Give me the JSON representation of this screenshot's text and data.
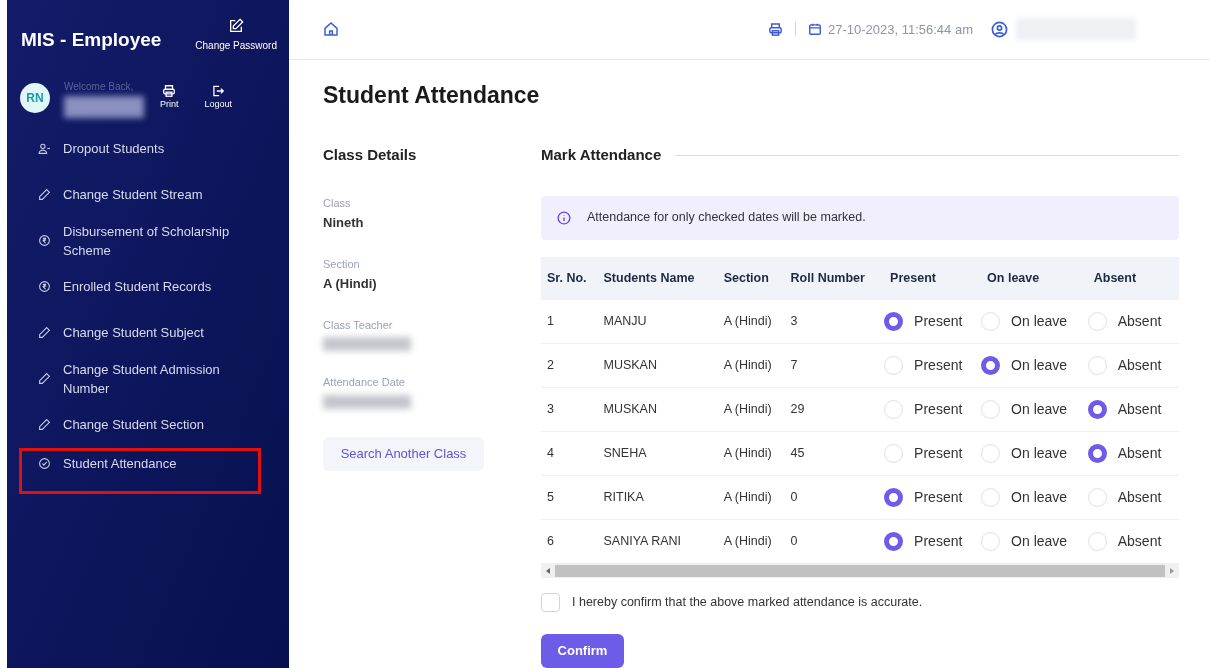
{
  "sidebar": {
    "app_title": "MIS - Employee",
    "change_password": "Change Password",
    "avatar": "RN",
    "welcome": "Welcome Back,",
    "print": "Print",
    "logout": "Logout",
    "items": [
      {
        "label": "Dropout Students",
        "kind": "person",
        "highlighted": false
      },
      {
        "label": "Change Student Stream",
        "kind": "pencil",
        "highlighted": false
      },
      {
        "label": "Disbursement of Scholarship Scheme",
        "kind": "coin",
        "highlighted": false
      },
      {
        "label": "Enrolled Student Records",
        "kind": "coin",
        "highlighted": false
      },
      {
        "label": "Change Student Subject",
        "kind": "pencil",
        "highlighted": false
      },
      {
        "label": "Change Student Admission Number",
        "kind": "pencil",
        "highlighted": false
      },
      {
        "label": "Change Student Section",
        "kind": "pencil",
        "highlighted": false
      },
      {
        "label": "Student Attendance",
        "kind": "check",
        "highlighted": true
      }
    ]
  },
  "topbar": {
    "datetime": "27-10-2023, 11:56:44 am"
  },
  "page_title": "Student Attendance",
  "class_details": {
    "title": "Class Details",
    "fields": [
      {
        "label": "Class",
        "value": "Nineth"
      },
      {
        "label": "Section",
        "value": "A (Hindi)"
      },
      {
        "label": "Class Teacher"
      },
      {
        "label": "Attendance Date"
      }
    ],
    "search_button": "Search Another Class"
  },
  "mark_attendance": {
    "title": "Mark Attendance",
    "notice": "Attendance for only checked dates will be marked.",
    "columns": [
      "Sr. No.",
      "Students Name",
      "Section",
      "Roll Number",
      "Present",
      "On leave",
      "Absent"
    ],
    "rows": [
      {
        "sr": "1",
        "name": "MANJU",
        "section": "A (Hindi)",
        "roll": "3",
        "options": [
          {
            "label": "Present",
            "selected": true
          },
          {
            "label": "On leave",
            "selected": false
          },
          {
            "label": "Absent",
            "selected": false
          }
        ]
      },
      {
        "sr": "2",
        "name": "MUSKAN",
        "section": "A (Hindi)",
        "roll": "7",
        "options": [
          {
            "label": "Present",
            "selected": false
          },
          {
            "label": "On leave",
            "selected": true
          },
          {
            "label": "Absent",
            "selected": false
          }
        ]
      },
      {
        "sr": "3",
        "name": "MUSKAN",
        "section": "A (Hindi)",
        "roll": "29",
        "options": [
          {
            "label": "Present",
            "selected": false
          },
          {
            "label": "On leave",
            "selected": false
          },
          {
            "label": "Absent",
            "selected": true
          }
        ]
      },
      {
        "sr": "4",
        "name": "SNEHA",
        "section": "A (Hindi)",
        "roll": "45",
        "options": [
          {
            "label": "Present",
            "selected": false
          },
          {
            "label": "On leave",
            "selected": false
          },
          {
            "label": "Absent",
            "selected": true
          }
        ]
      },
      {
        "sr": "5",
        "name": "RITIKA",
        "section": "A (Hindi)",
        "roll": "0",
        "options": [
          {
            "label": "Present",
            "selected": true
          },
          {
            "label": "On leave",
            "selected": false
          },
          {
            "label": "Absent",
            "selected": false
          }
        ]
      },
      {
        "sr": "6",
        "name": "SANIYA RANI",
        "section": "A (Hindi)",
        "roll": "0",
        "options": [
          {
            "label": "Present",
            "selected": true
          },
          {
            "label": "On leave",
            "selected": false
          },
          {
            "label": "Absent",
            "selected": false
          }
        ]
      }
    ],
    "confirm_text": "I hereby confirm that the above marked attendance is accurate.",
    "confirm_checked": false,
    "confirm_button": "Confirm"
  }
}
